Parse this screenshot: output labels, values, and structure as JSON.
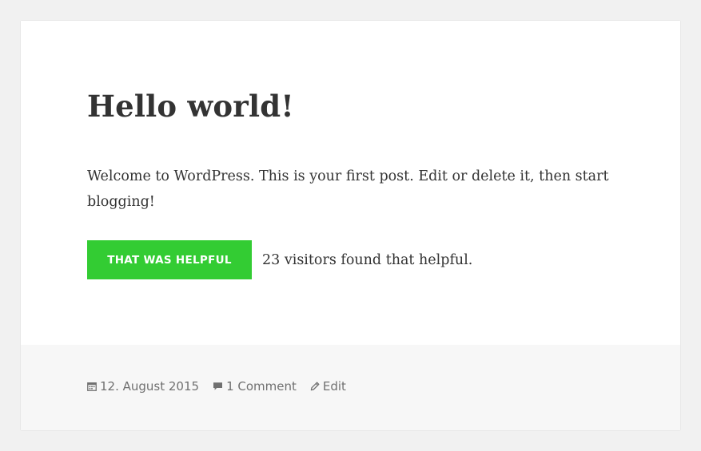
{
  "post": {
    "title": "Hello world!",
    "content": "Welcome to WordPress. This is your first post. Edit or delete it, then start blogging!"
  },
  "helpful": {
    "button_label": "THAT WAS HELPFUL",
    "count_text": "23 visitors found that helpful.",
    "button_color": "#33cc33"
  },
  "meta": {
    "date": "12. August 2015",
    "comments": "1 Comment",
    "edit": "Edit",
    "icons": [
      "calendar-icon",
      "comment-icon",
      "pencil-icon"
    ]
  }
}
